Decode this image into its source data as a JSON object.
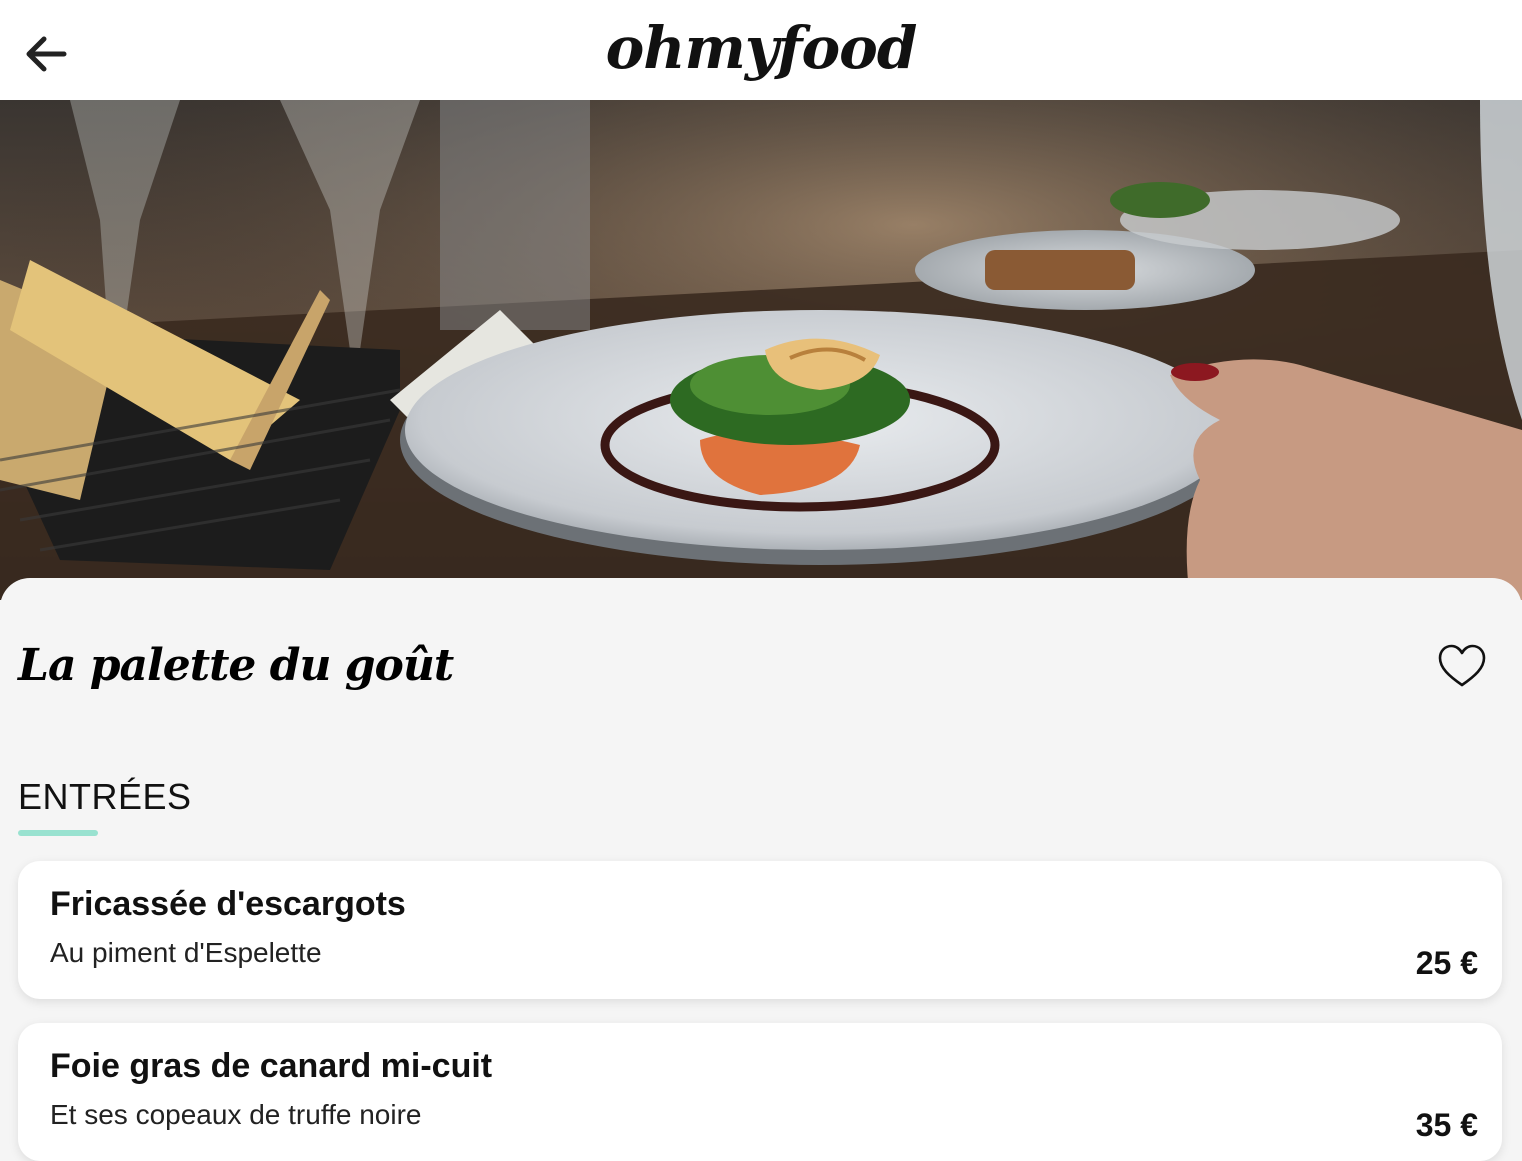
{
  "header": {
    "logo_text": "ohmyfood",
    "back_icon": "arrow-left-icon"
  },
  "hero": {
    "description_icon": "restaurant-photo"
  },
  "restaurant": {
    "name": "La palette du goût",
    "like_icon": "heart-outline-icon"
  },
  "menu": {
    "section_title": "ENTRÉES",
    "accent_color": "#99e2d0",
    "dishes": [
      {
        "name": "Fricassée d'escargots",
        "description": "Au piment d'Espelette",
        "price": "25 €"
      },
      {
        "name": "Foie gras de canard mi-cuit",
        "description": "Et ses copeaux de truffe noire",
        "price": "35 €"
      }
    ]
  }
}
